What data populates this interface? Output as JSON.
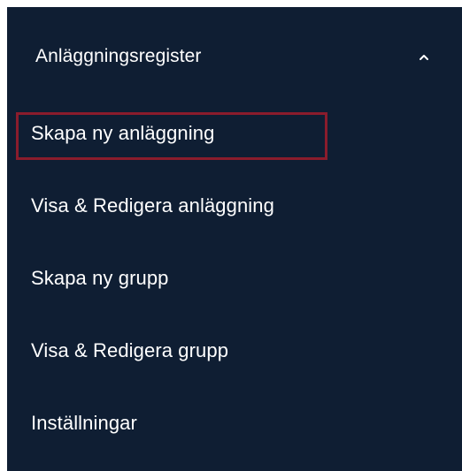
{
  "sidebar": {
    "section": {
      "title": "Anläggningsregister",
      "expanded": true,
      "chevron_icon": "chevron-up-icon"
    },
    "items": [
      {
        "label": "Skapa ny anläggning",
        "highlighted": true
      },
      {
        "label": "Visa & Redigera anläggning"
      },
      {
        "label": "Skapa ny grupp"
      },
      {
        "label": "Visa & Redigera grupp"
      },
      {
        "label": "Inställningar"
      }
    ],
    "colors": {
      "background": "#0f1e33",
      "text": "#ffffff",
      "highlight_border": "#8a1c2c"
    }
  }
}
